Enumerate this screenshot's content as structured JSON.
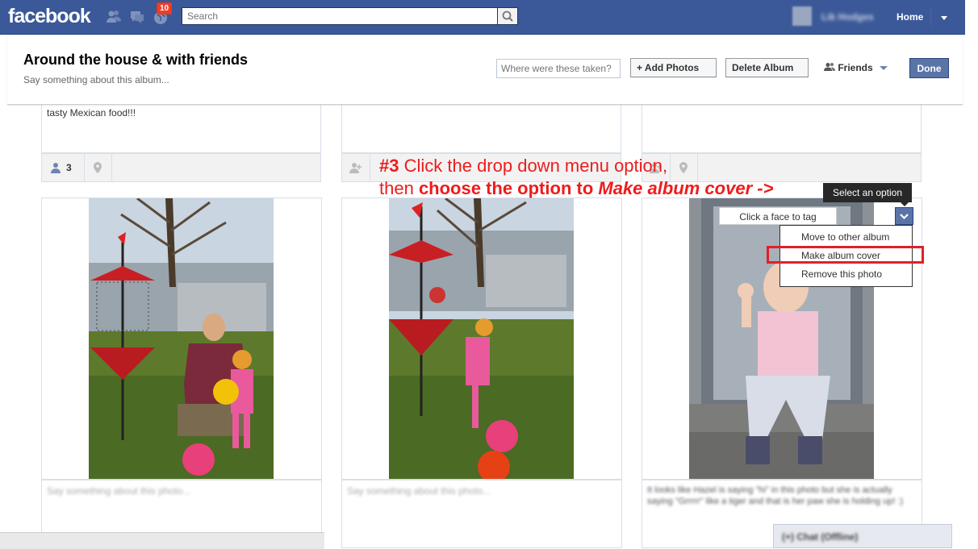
{
  "topbar": {
    "logo": "facebook",
    "notification_count": "10",
    "search_placeholder": "Search",
    "profile_name": "Lik Hodges",
    "home_label": "Home"
  },
  "album": {
    "title": "Around the house & with friends",
    "description_placeholder": "Say something about this album...",
    "location_placeholder": "Where were these taken?",
    "add_photos_label": "+ Add Photos",
    "delete_album_label": "Delete Album",
    "privacy_label": "Friends",
    "done_label": "Done"
  },
  "top_row": {
    "card1_text": "tasty Mexican food!!!",
    "card1_tag_count": "3"
  },
  "annotation": {
    "line1_prefix": "#3",
    "line1_rest": " Click the drop down menu option,",
    "line2_prefix": "then ",
    "line2_bold": "choose the option to ",
    "line2_italic": "Make album cover ->"
  },
  "photo_menu": {
    "tooltip": "Select an option",
    "face_tag_label": "Click a face to tag",
    "items": [
      "Move to other album",
      "Make album cover",
      "Remove this photo"
    ]
  },
  "captions": {
    "placeholder": "Say something about this photo...",
    "card3_text": "It looks like Hazel is saying \"hi\" in this photo but she is actually saying \"Grrrrr\" like a tiger and that is her paw she is holding up! :)"
  },
  "chat": {
    "label": "(+) Chat (Offline)"
  },
  "colors": {
    "brand": "#3b5998",
    "annotation": "#ee1c1c",
    "highlight": "#e0202a"
  }
}
